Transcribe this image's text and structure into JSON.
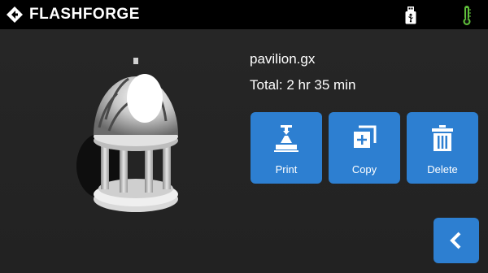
{
  "header": {
    "brand_name": "FLASHFORGE",
    "icons": [
      "flashforge-logo-icon",
      "usb-drive-icon",
      "thermometer-icon"
    ]
  },
  "file": {
    "name": "pavilion.gx",
    "total_time": "Total: 2 hr 35 min"
  },
  "actions": {
    "print_label": "Print",
    "copy_label": "Copy",
    "delete_label": "Delete"
  },
  "colors": {
    "accent": "#2d7fd1",
    "header_bg": "#000000",
    "content_bg": "#242424",
    "thermometer": "#5fbf3a"
  }
}
